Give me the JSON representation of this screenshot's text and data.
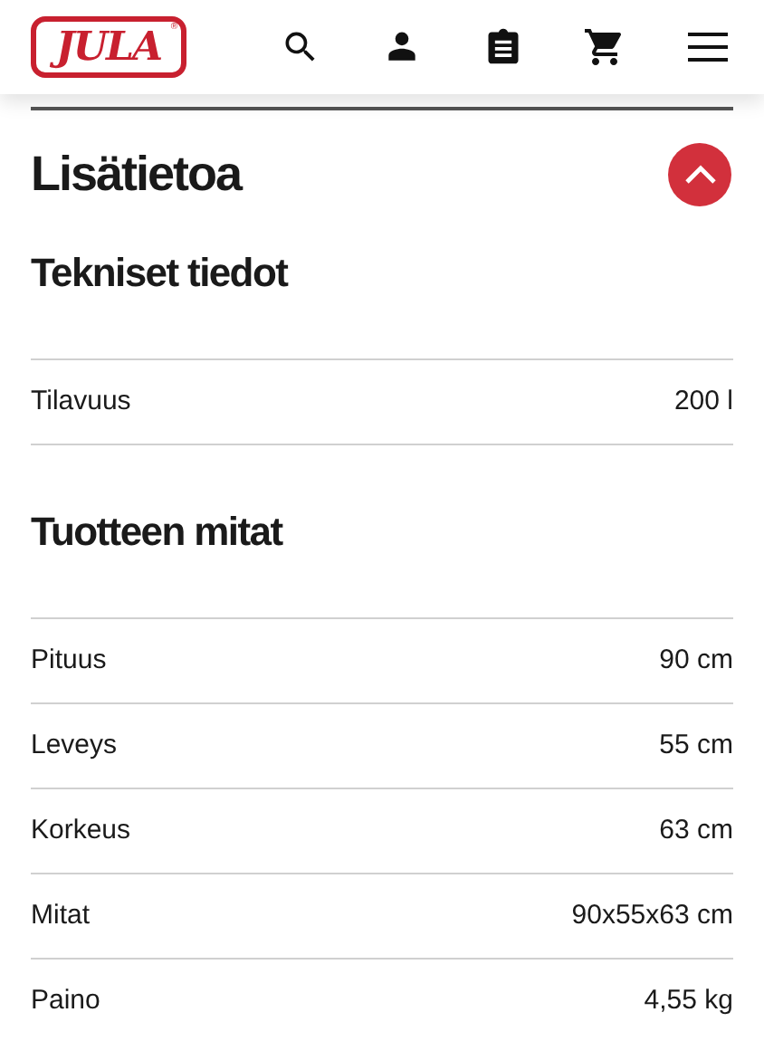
{
  "header": {
    "logo": "JULA",
    "logo_mark": "®"
  },
  "panel": {
    "title": "Lisätietoa",
    "expanded": true
  },
  "sections": [
    {
      "title": "Tekniset tiedot",
      "rows": [
        {
          "label": "Tilavuus",
          "value": "200 l"
        }
      ]
    },
    {
      "title": "Tuotteen mitat",
      "rows": [
        {
          "label": "Pituus",
          "value": "90 cm"
        },
        {
          "label": "Leveys",
          "value": "55 cm"
        },
        {
          "label": "Korkeus",
          "value": "63 cm"
        },
        {
          "label": "Mitat",
          "value": "90x55x63 cm"
        },
        {
          "label": "Paino",
          "value": "4,55 kg"
        }
      ]
    }
  ]
}
